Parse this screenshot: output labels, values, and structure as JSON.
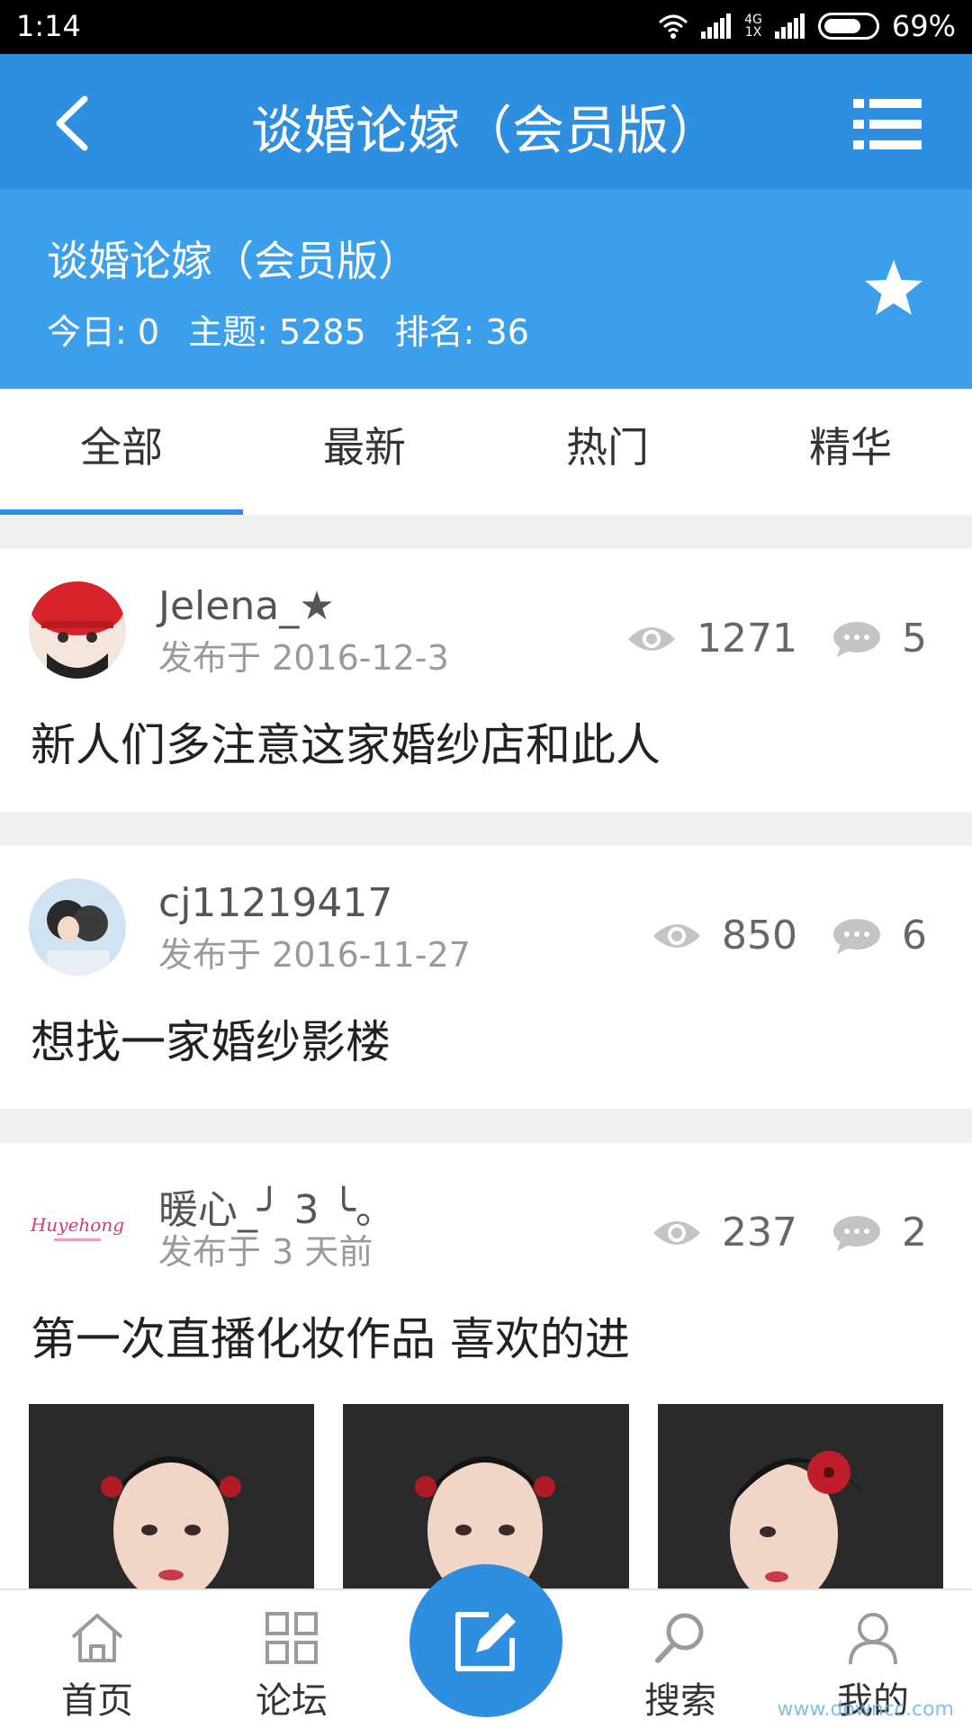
{
  "status": {
    "time": "1:14",
    "net_top": "4G",
    "net_bottom": "1X",
    "battery": "69%"
  },
  "nav": {
    "title": "谈婚论嫁（会员版）"
  },
  "forum": {
    "name": "谈婚论嫁（会员版）",
    "today": "今日: 0",
    "topics": "主题: 5285",
    "rank": "排名: 36"
  },
  "tabs": [
    "全部",
    "最新",
    "热门",
    "精华"
  ],
  "posts": [
    {
      "author": "Jelena_★",
      "date": "发布于 2016-12-3",
      "views": "1271",
      "comments": "5",
      "title": "新人们多注意这家婚纱店和此人"
    },
    {
      "author": "cj11219417",
      "date": "发布于 2016-11-27",
      "views": "850",
      "comments": "6",
      "title": "想找一家婚纱影楼"
    },
    {
      "author": "暖心_╯ 3 ╰。",
      "date": "发布于 3 天前",
      "views": "237",
      "comments": "2",
      "title": "第一次直播化妆作品 喜欢的进",
      "avatar_logo": "Huyehong"
    }
  ],
  "bottom_nav": {
    "home": "首页",
    "forum": "论坛",
    "search": "搜索",
    "mine": "我的"
  },
  "watermark": "www.downcc.com",
  "colors": {
    "primary": "#2e8fe1",
    "header": "#3c9fec"
  }
}
